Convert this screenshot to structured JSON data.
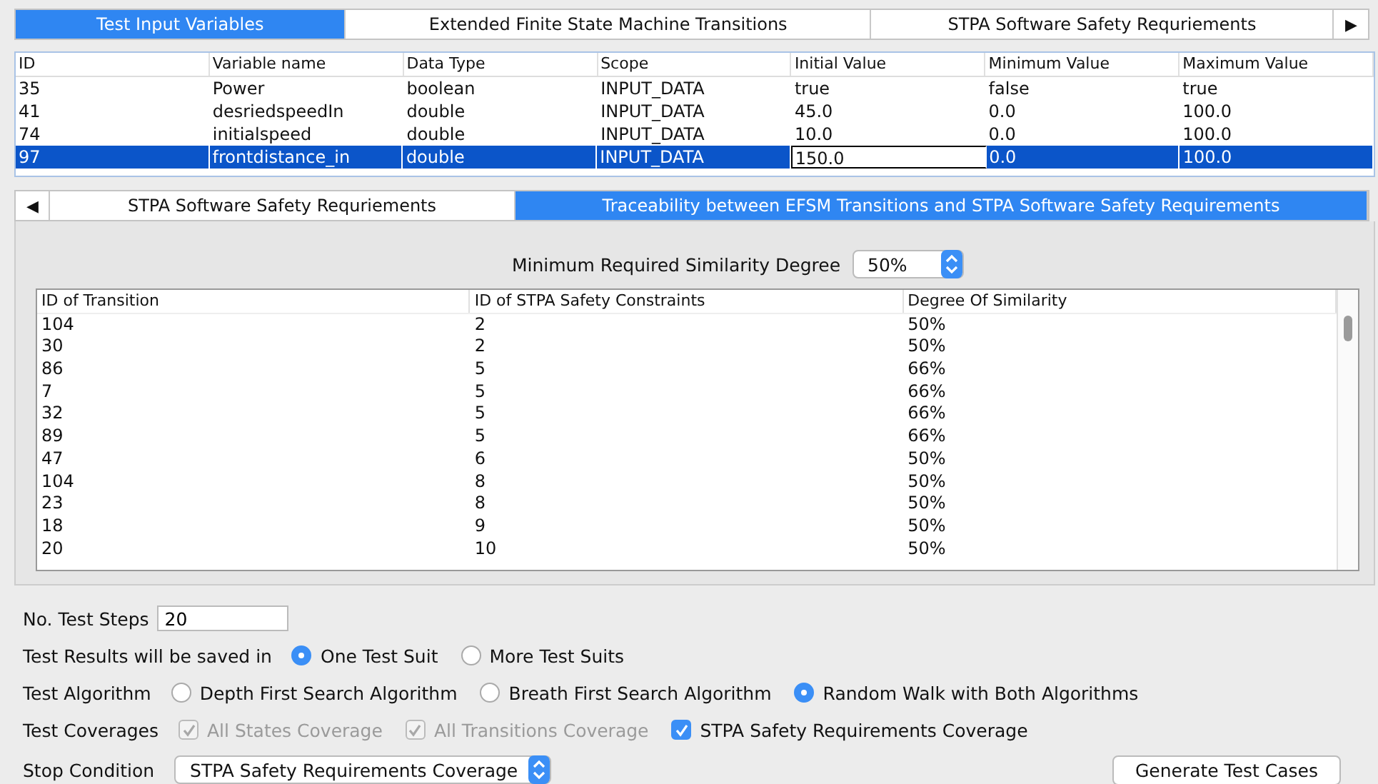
{
  "top_tabs": [
    {
      "label": "Test Input Variables",
      "selected": true
    },
    {
      "label": "Extended Finite State Machine Transitions",
      "selected": false
    },
    {
      "label": "STPA Software Safety Requriements",
      "selected": false
    }
  ],
  "top_tabs_next": "▶",
  "variables_table": {
    "columns": [
      "ID",
      "Variable name",
      "Data Type",
      "Scope",
      "Initial Value",
      "Minimum Value",
      "Maximum Value"
    ],
    "rows": [
      {
        "cells": [
          "35",
          "Power",
          "boolean",
          "INPUT_DATA",
          "true",
          "false",
          "true"
        ],
        "editing": [
          false,
          false,
          false,
          false,
          false,
          false,
          false
        ],
        "selected": false
      },
      {
        "cells": [
          "41",
          "desriedspeedIn",
          "double",
          "INPUT_DATA",
          "45.0",
          "0.0",
          "100.0"
        ],
        "editing": [
          false,
          false,
          false,
          false,
          false,
          false,
          false
        ],
        "selected": false
      },
      {
        "cells": [
          "74",
          "initialspeed",
          "double",
          "INPUT_DATA",
          "10.0",
          "0.0",
          "100.0"
        ],
        "editing": [
          false,
          false,
          false,
          false,
          false,
          false,
          false
        ],
        "selected": false
      },
      {
        "cells": [
          "97",
          "frontdistance_in",
          "double",
          "INPUT_DATA",
          "150.0",
          "0.0",
          "100.0"
        ],
        "editing": [
          false,
          false,
          false,
          false,
          true,
          false,
          false
        ],
        "selected": true
      }
    ]
  },
  "sub_tabs_prev": "◀",
  "sub_tabs": [
    {
      "label": "STPA Software Safety Requriements",
      "selected": false
    },
    {
      "label": "Traceability between EFSM Transitions and STPA Software Safety Requirements",
      "selected": true
    }
  ],
  "similarity": {
    "label": "Minimum Required Similarity Degree",
    "value": "50%"
  },
  "trace_table": {
    "columns": [
      "ID of Transition",
      "ID of STPA Safety Constraints",
      "Degree Of Similarity"
    ],
    "rows": [
      [
        "104",
        "2",
        "50%"
      ],
      [
        "30",
        "2",
        "50%"
      ],
      [
        "86",
        "5",
        "66%"
      ],
      [
        "7",
        "5",
        "66%"
      ],
      [
        "32",
        "5",
        "66%"
      ],
      [
        "89",
        "5",
        "66%"
      ],
      [
        "47",
        "6",
        "50%"
      ],
      [
        "104",
        "8",
        "50%"
      ],
      [
        "23",
        "8",
        "50%"
      ],
      [
        "18",
        "9",
        "50%"
      ],
      [
        "20",
        "10",
        "50%"
      ]
    ]
  },
  "test_steps": {
    "label": "No. Test Steps",
    "value": "20"
  },
  "save_in": {
    "label": "Test Results will be saved in",
    "options": [
      {
        "label": "One Test Suit",
        "selected": true
      },
      {
        "label": "More Test Suits",
        "selected": false
      }
    ]
  },
  "algorithm": {
    "label": "Test Algorithm",
    "options": [
      {
        "label": "Depth First Search Algorithm",
        "selected": false
      },
      {
        "label": "Breath First Search Algorithm",
        "selected": false
      },
      {
        "label": "Random Walk with Both Algorithms",
        "selected": true
      }
    ]
  },
  "coverages": {
    "label": "Test Coverages",
    "options": [
      {
        "label": "All States Coverage",
        "checked": true,
        "disabled": true
      },
      {
        "label": "All Transitions Coverage",
        "checked": true,
        "disabled": true
      },
      {
        "label": "STPA Safety Requirements Coverage",
        "checked": true,
        "disabled": false
      }
    ]
  },
  "stop_condition": {
    "label": "Stop Condition",
    "value": "STPA Safety Requirements Coverage"
  },
  "generate_button": "Generate Test Cases"
}
